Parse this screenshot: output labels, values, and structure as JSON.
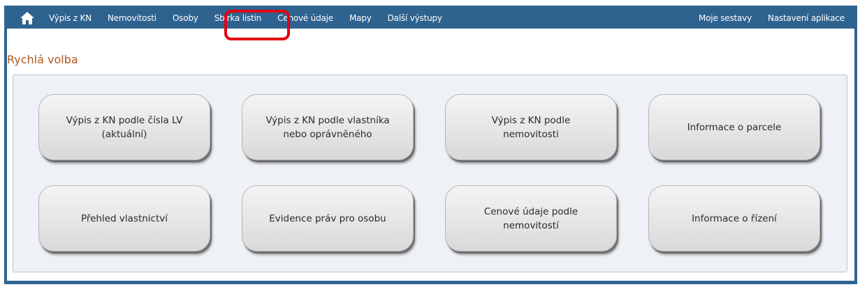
{
  "nav": {
    "home_icon": "home-icon",
    "items": [
      "Výpis z KN",
      "Nemovitosti",
      "Osoby",
      "Sbírka listin",
      "Cenové údaje",
      "Mapy",
      "Další výstupy"
    ],
    "right_items": [
      "Moje sestavy",
      "Nastavení aplikace"
    ]
  },
  "page": {
    "title": "Rychlá volba"
  },
  "quick_buttons": [
    "Výpis z KN podle čísla LV (aktuální)",
    "Výpis z KN podle vlastníka nebo oprávněného",
    "Výpis z KN podle nemovitosti",
    "Informace o parcele",
    "Přehled vlastnictví",
    "Evidence práv pro osobu",
    "Cenové údaje podle nemovitostí",
    "Informace o řízení"
  ],
  "colors": {
    "navbar": "#2e628f",
    "title": "#b0561a",
    "highlight": "#e3000f"
  }
}
